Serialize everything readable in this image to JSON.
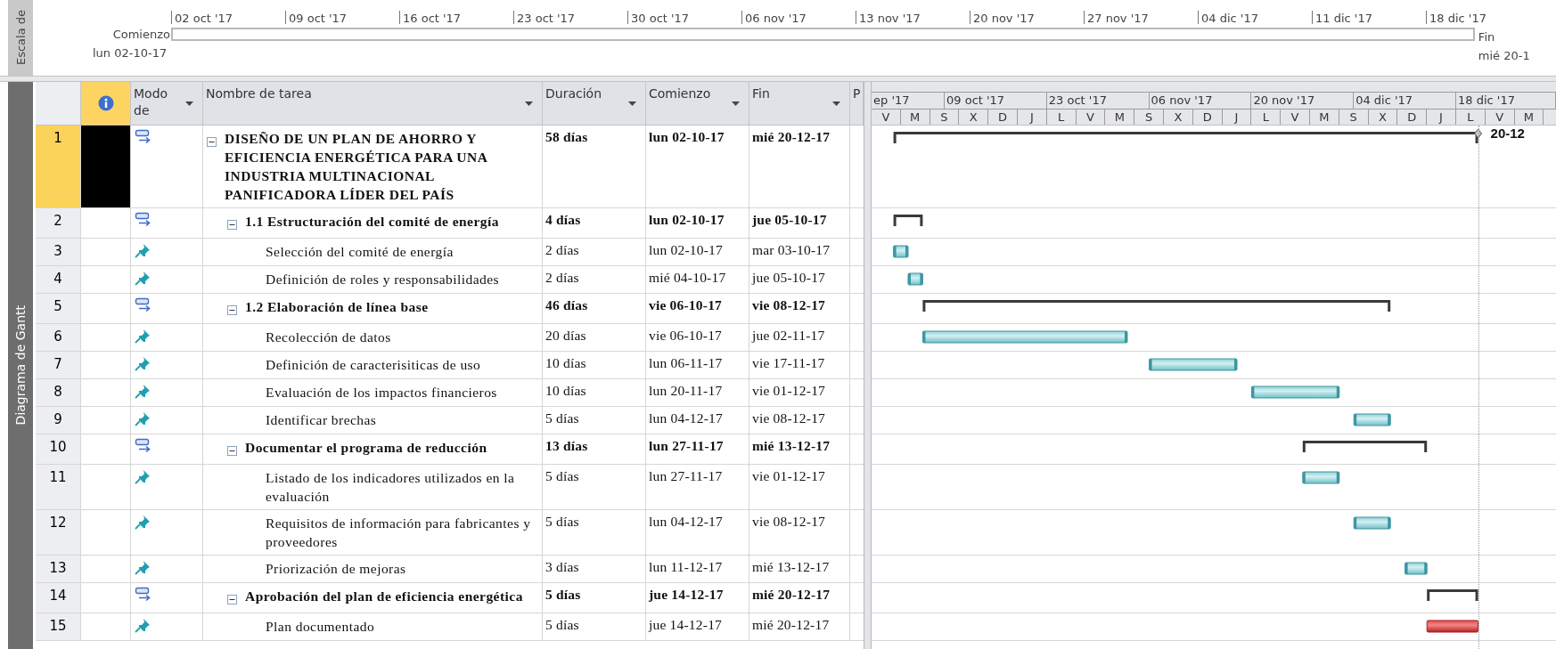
{
  "timescale": {
    "side_label": "Escala de",
    "ticks": [
      "02 oct '17",
      "09 oct '17",
      "16 oct '17",
      "23 oct '17",
      "30 oct '17",
      "06 nov '17",
      "13 nov '17",
      "20 nov '17",
      "27 nov '17",
      "04 dic '17",
      "11 dic '17",
      "18 dic '17"
    ],
    "start_label": "Comienzo",
    "start_date": "lun 02-10-17",
    "finish_label": "Fin",
    "finish_date": "mié 20-1"
  },
  "view_label": "Diagrama de Gantt",
  "table": {
    "columns": [
      {
        "label": "Modo de",
        "menu": true
      },
      {
        "label": "Nombre de tarea",
        "menu": true
      },
      {
        "label": "Duración",
        "menu": true
      },
      {
        "label": "Comienzo",
        "menu": true
      },
      {
        "label": "Fin",
        "menu": true
      },
      {
        "label": "P",
        "menu": false
      }
    ],
    "rows": [
      {
        "number": "1",
        "name": "DISEÑO DE UN PLAN DE AHORRO Y EFICIENCIA ENERGÉTICA PARA UNA INDUSTRIA MULTINACIONAL PANIFICADORA LÍDER DEL PAÍS",
        "duration": "58 días",
        "start": "lun 02-10-17",
        "finish": "mié 20-12-17",
        "kind": "summary",
        "expanded": true,
        "selected": true,
        "bar_label": "20-12",
        "children": [
          {
            "number": "2",
            "name": "1.1 Estructuración del comité de energía",
            "duration": "4 días",
            "start": "lun 02-10-17",
            "finish": "jue 05-10-17",
            "kind": "summary",
            "expanded": true,
            "selected": false,
            "children": [
              {
                "number": "3",
                "name": "Selección del comité de energía",
                "duration": "2 días",
                "start": "lun 02-10-17",
                "finish": "mar 03-10-17",
                "kind": "task",
                "selected": false,
                "critical": false
              },
              {
                "number": "4",
                "name": "Definición de roles y responsabilidades",
                "duration": "2 días",
                "start": "mié 04-10-17",
                "finish": "jue 05-10-17",
                "kind": "task",
                "selected": false,
                "critical": false
              }
            ]
          },
          {
            "number": "5",
            "name": "1.2 Elaboración de línea base",
            "duration": "46 días",
            "start": "vie 06-10-17",
            "finish": "vie 08-12-17",
            "kind": "summary",
            "expanded": true,
            "selected": false,
            "children": [
              {
                "number": "6",
                "name": "Recolección de datos",
                "duration": "20 días",
                "start": "vie 06-10-17",
                "finish": "jue 02-11-17",
                "kind": "task",
                "selected": false,
                "critical": false
              },
              {
                "number": "7",
                "name": "Definición de caracterisiticas de uso",
                "duration": "10 días",
                "start": "lun 06-11-17",
                "finish": "vie 17-11-17",
                "kind": "task",
                "selected": false,
                "critical": false
              },
              {
                "number": "8",
                "name": "Evaluación de los impactos financieros",
                "duration": "10 días",
                "start": "lun 20-11-17",
                "finish": "vie 01-12-17",
                "kind": "task",
                "selected": false,
                "critical": false
              },
              {
                "number": "9",
                "name": "Identificar brechas",
                "duration": "5 días",
                "start": "lun 04-12-17",
                "finish": "vie 08-12-17",
                "kind": "task",
                "selected": false,
                "critical": false
              }
            ]
          },
          {
            "number": "10",
            "name": "Documentar el programa de reducción",
            "duration": "13 días",
            "start": "lun 27-11-17",
            "finish": "mié 13-12-17",
            "kind": "summary",
            "expanded": true,
            "selected": false,
            "children": [
              {
                "number": "11",
                "name": "Listado de los indicadores utilizados en la evaluación",
                "duration": "5 días",
                "start": "lun 27-11-17",
                "finish": "vie 01-12-17",
                "kind": "task",
                "selected": false,
                "critical": false
              },
              {
                "number": "12",
                "name": "Requisitos de información para fabricantes y proveedores",
                "duration": "5 días",
                "start": "lun 04-12-17",
                "finish": "vie 08-12-17",
                "kind": "task",
                "selected": false,
                "critical": false
              },
              {
                "number": "13",
                "name": "Priorización de mejoras",
                "duration": "3 días",
                "start": "lun 11-12-17",
                "finish": "mié 13-12-17",
                "kind": "task",
                "selected": false,
                "critical": false
              }
            ]
          },
          {
            "number": "14",
            "name": "Aprobación del plan de eficiencia energética",
            "duration": "5 días",
            "start": "jue 14-12-17",
            "finish": "mié 20-12-17",
            "kind": "summary",
            "expanded": true,
            "selected": false,
            "children": [
              {
                "number": "15",
                "name": "Plan documentado",
                "duration": "5 días",
                "start": "jue 14-12-17",
                "finish": "mié 20-12-17",
                "kind": "task",
                "selected": false,
                "critical": true
              }
            ]
          }
        ]
      }
    ]
  },
  "gantt": {
    "periods": [
      "ep '17",
      "09 oct '17",
      "23 oct '17",
      "06 nov '17",
      "20 nov '17",
      "04 dic '17",
      "18 dic '17"
    ],
    "days": [
      "V",
      "M",
      "S",
      "X",
      "D",
      "J",
      "L",
      "V",
      "M",
      "S",
      "X",
      "D",
      "J",
      "L",
      "V",
      "M",
      "S",
      "X",
      "D",
      "J",
      "L",
      "V",
      "M"
    ]
  }
}
